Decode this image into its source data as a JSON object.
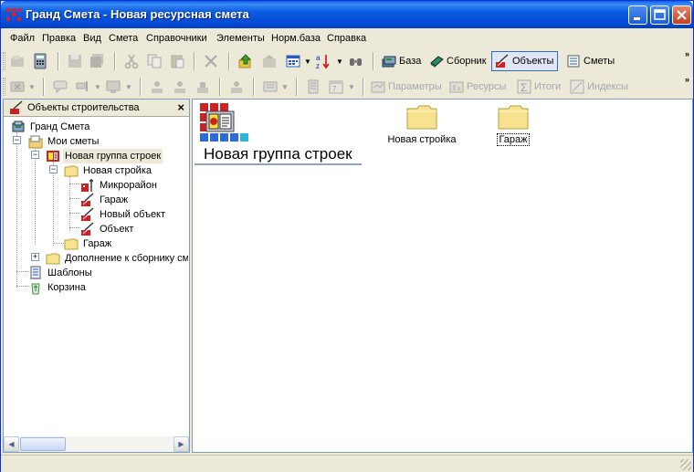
{
  "window": {
    "title": "Гранд Смета - Новая ресурсная смета",
    "controls": [
      "minimize",
      "maximize",
      "close"
    ]
  },
  "menu": [
    "Файл",
    "Правка",
    "Вид",
    "Смета",
    "Справочники",
    "Элементы",
    "Норм.база",
    "Справка"
  ],
  "toolbar1": {
    "labeled_buttons": [
      {
        "label": "База",
        "icon": "database-icon"
      },
      {
        "label": "Сборник",
        "icon": "book-icon"
      },
      {
        "label": "Объекты",
        "icon": "objects-icon",
        "pressed": true
      },
      {
        "label": "Сметы",
        "icon": "estimate-icon"
      }
    ]
  },
  "toolbar2": {
    "labeled_buttons": [
      {
        "label": "Параметры",
        "icon": "parameters-icon",
        "disabled": true
      },
      {
        "label": "Ресурсы",
        "icon": "resources-icon",
        "disabled": true
      },
      {
        "label": "Итоги",
        "icon": "sum-icon",
        "disabled": true
      },
      {
        "label": "Индексы",
        "icon": "index-icon",
        "disabled": true
      }
    ]
  },
  "left_panel": {
    "title": "Объекты строительства",
    "close_glyph": "×",
    "tree": [
      {
        "label": "Гранд Смета",
        "icon": "root-icon"
      },
      {
        "label": "Мои сметы",
        "icon": "my-estimates-icon"
      },
      {
        "label": "Новая группа строек",
        "icon": "group-icon",
        "selected": true
      },
      {
        "label": "Новая стройка",
        "icon": "folder-icon"
      },
      {
        "label": "Микрорайон",
        "icon": "object-icon"
      },
      {
        "label": "Гараж",
        "icon": "object-icon"
      },
      {
        "label": "Новый объект",
        "icon": "object-icon"
      },
      {
        "label": "Объект",
        "icon": "object-icon"
      },
      {
        "label": "Гараж",
        "icon": "folder-icon"
      },
      {
        "label": "Дополнение к сборнику см",
        "icon": "folder-icon"
      },
      {
        "label": "Шаблоны",
        "icon": "templates-icon"
      },
      {
        "label": "Корзина",
        "icon": "recycle-icon"
      }
    ]
  },
  "main": {
    "group_title": "Новая группа строек",
    "items": [
      {
        "label": "Новая стройка",
        "icon": "folder-icon"
      },
      {
        "label": "Гараж",
        "icon": "folder-icon",
        "focused": true
      }
    ]
  },
  "colors": {
    "titlebar": "#0449d4",
    "selection_border": "#316ac5",
    "folder": "#f6e28f"
  }
}
